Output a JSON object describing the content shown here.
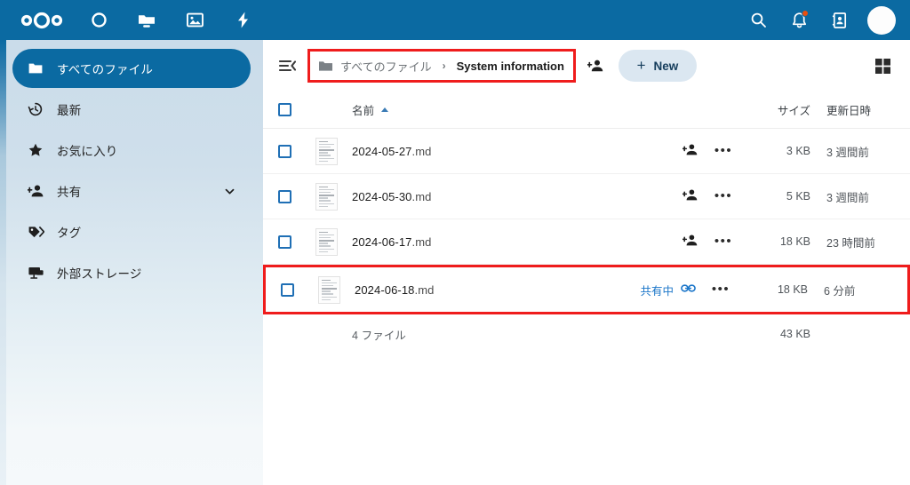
{
  "header": {
    "app_name": "Nextcloud",
    "logo_icon": "nextcloud-logo",
    "nav_items": [
      {
        "name": "dashboard",
        "icon": "circle-icon"
      },
      {
        "name": "files",
        "icon": "folder-icon"
      },
      {
        "name": "photos",
        "icon": "image-icon"
      },
      {
        "name": "activity",
        "icon": "lightning-bolt-icon"
      }
    ],
    "right_items": [
      {
        "name": "search",
        "icon": "search-icon",
        "badge": false
      },
      {
        "name": "notifications",
        "icon": "bell-icon",
        "badge": true
      },
      {
        "name": "contacts",
        "icon": "contacts-icon",
        "badge": false
      },
      {
        "name": "user-avatar",
        "icon": "avatar-icon",
        "badge": false
      }
    ],
    "accent_color": "#0b6aa2",
    "badge_color": "#e8500f"
  },
  "sidebar": {
    "items": [
      {
        "label": "すべてのファイル",
        "icon": "folder-icon",
        "active": true,
        "chevron": false
      },
      {
        "label": "最新",
        "icon": "clock-recent-icon",
        "active": false,
        "chevron": false
      },
      {
        "label": "お気に入り",
        "icon": "star-icon",
        "active": false,
        "chevron": false
      },
      {
        "label": "共有",
        "icon": "account-plus-icon",
        "active": false,
        "chevron": true
      },
      {
        "label": "タグ",
        "icon": "tag-icon",
        "active": false,
        "chevron": false
      },
      {
        "label": "外部ストレージ",
        "icon": "external-storage-icon",
        "active": false,
        "chevron": false
      }
    ],
    "active_pill_color": "#0b6aa2"
  },
  "toolbar": {
    "collapse_icon": "collapse-sidebar-icon",
    "breadcrumb": {
      "folder_icon": "folder-icon",
      "separator": "›",
      "items": [
        {
          "label": "すべてのファイル",
          "current": false
        },
        {
          "label": "System information",
          "current": true
        }
      ],
      "highlight_color": "#ef1c1c",
      "highlighted": true
    },
    "share_icon": "account-plus-icon",
    "new_button": {
      "label": "New",
      "plus": "+",
      "icon": "plus-icon"
    },
    "grid_toggle_icon": "grid-view-icon"
  },
  "table": {
    "columns": {
      "name": "名前",
      "size": "サイズ",
      "modified": "更新日時"
    },
    "sort": {
      "column": "名前",
      "direction": "ascending",
      "arrow": "▲"
    },
    "select_all_checkbox": false,
    "rows": [
      {
        "name": "2024-05-27",
        "ext": ".md",
        "thumb_icon": "document-thumbnail",
        "shared_label": "",
        "share_icon": "account-plus-icon",
        "link_icon": "",
        "actions_icon": "more-actions-icon",
        "size": "3 KB",
        "modified": "3 週間前",
        "checked": false,
        "highlighted": false
      },
      {
        "name": "2024-05-30",
        "ext": ".md",
        "thumb_icon": "document-thumbnail",
        "shared_label": "",
        "share_icon": "account-plus-icon",
        "link_icon": "",
        "actions_icon": "more-actions-icon",
        "size": "5 KB",
        "modified": "3 週間前",
        "checked": false,
        "highlighted": false
      },
      {
        "name": "2024-06-17",
        "ext": ".md",
        "thumb_icon": "document-thumbnail",
        "shared_label": "",
        "share_icon": "account-plus-icon",
        "link_icon": "",
        "actions_icon": "more-actions-icon",
        "size": "18 KB",
        "modified": "23 時間前",
        "checked": false,
        "highlighted": false
      },
      {
        "name": "2024-06-18",
        "ext": ".md",
        "thumb_icon": "document-thumbnail",
        "shared_label": "共有中",
        "share_icon": "",
        "link_icon": "link-icon",
        "actions_icon": "more-actions-icon",
        "size": "18 KB",
        "modified": "6 分前",
        "checked": false,
        "highlighted": true
      }
    ],
    "footer": {
      "file_count": "4 ファイル",
      "total_size": "43 KB"
    }
  }
}
